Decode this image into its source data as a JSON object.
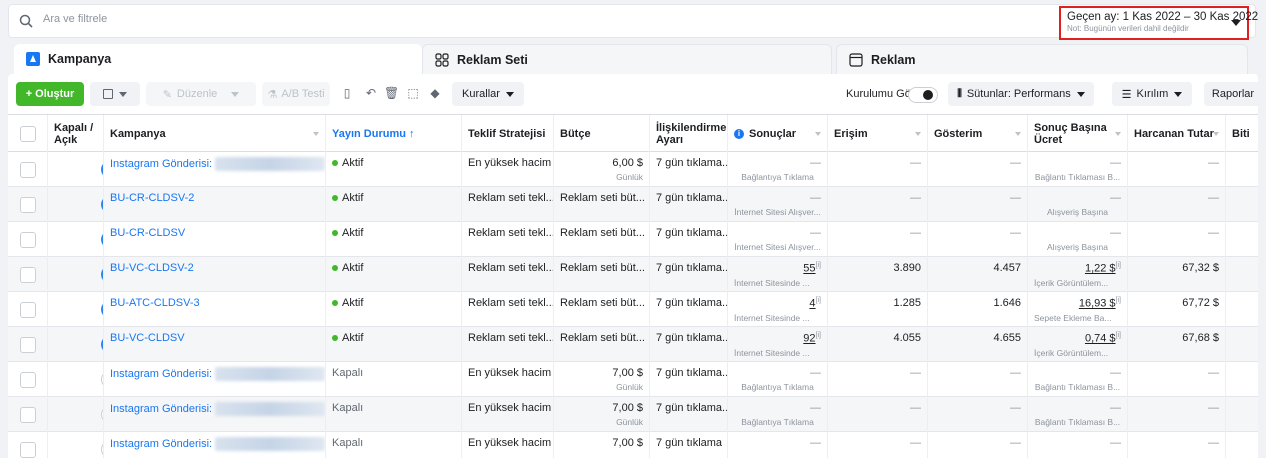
{
  "search": {
    "placeholder": "Ara ve filtrele"
  },
  "date_range": {
    "label": "Geçen ay: 1 Kas 2022 – 30 Kas 2022",
    "note": "Not: Bugünün verileri dahil değildir"
  },
  "tabs": [
    {
      "label": "Kampanya"
    },
    {
      "label": "Reklam Seti"
    },
    {
      "label": "Reklam"
    }
  ],
  "toolbar": {
    "create": "+ Oluştur",
    "edit": "Düzenle",
    "ab_test": "A/B Testi",
    "rules": "Kurallar",
    "setup_view": "Kurulumu Gör",
    "columns": "Sütunlar: Performans",
    "breakdown": "Kırılım",
    "reports": "Raporlar"
  },
  "columns": {
    "onoff": "Kapalı / Açık",
    "campaign": "Kampanya",
    "delivery": "Yayın Durumu ↑",
    "bid": "Teklif Stratejisi",
    "budget": "Bütçe",
    "attribution": "İlişkilendirme Ayarı",
    "results": "Sonuçlar",
    "reach": "Erişim",
    "impressions": "Gösterim",
    "cpr": "Sonuç Başına Ücret",
    "spent": "Harcanan Tutar",
    "ends": "Biti"
  },
  "rows": [
    {
      "on": true,
      "name": "Instagram Gönderisi:",
      "blur": true,
      "status": "Aktif",
      "active": true,
      "bid": "En yüksek hacim",
      "budget": "6,00 $",
      "budget_sub": "Günlük",
      "attr": "7 gün tıklama...",
      "results": "—",
      "results_sub": "Bağlantıya Tıklama",
      "results_link": false,
      "reach": "—",
      "impr": "—",
      "cpr": "—",
      "cpr_sub": "Bağlantı Tıklaması B...",
      "cpr_link": false,
      "spent": "—"
    },
    {
      "on": true,
      "name": "BU-CR-CLDSV-2",
      "blur": false,
      "status": "Aktif",
      "active": true,
      "bid": "Reklam seti tekl...",
      "budget": "Reklam seti büt...",
      "budget_sub": "",
      "attr": "7 gün tıklama...",
      "results": "—",
      "results_sub": "İnternet Sitesi Alışver...",
      "results_link": false,
      "reach": "—",
      "impr": "—",
      "cpr": "—",
      "cpr_sub": "Alışveriş Başına",
      "cpr_link": false,
      "spent": "—"
    },
    {
      "on": true,
      "name": "BU-CR-CLDSV",
      "blur": false,
      "status": "Aktif",
      "active": true,
      "bid": "Reklam seti tekl...",
      "budget": "Reklam seti büt...",
      "budget_sub": "",
      "attr": "7 gün tıklama...",
      "results": "—",
      "results_sub": "İnternet Sitesi Alışver...",
      "results_link": false,
      "reach": "—",
      "impr": "—",
      "cpr": "—",
      "cpr_sub": "Alışveriş Başına",
      "cpr_link": false,
      "spent": "—"
    },
    {
      "on": true,
      "name": "BU-VC-CLDSV-2",
      "blur": false,
      "status": "Aktif",
      "active": true,
      "bid": "Reklam seti tekl...",
      "budget": "Reklam seti büt...",
      "budget_sub": "",
      "attr": "7 gün tıklama...",
      "results": "55",
      "results_sub": "İnternet Sitesinde ...",
      "results_link": true,
      "reach": "3.890",
      "impr": "4.457",
      "cpr": "1,22 $",
      "cpr_sub": "İçerik Görüntülem...",
      "cpr_link": true,
      "spent": "67,32 $"
    },
    {
      "on": true,
      "name": "BU-ATC-CLDSV-3",
      "blur": false,
      "status": "Aktif",
      "active": true,
      "bid": "Reklam seti tekl...",
      "budget": "Reklam seti büt...",
      "budget_sub": "",
      "attr": "7 gün tıklama...",
      "results": "4",
      "results_sub": "İnternet Sitesinde ...",
      "results_link": true,
      "reach": "1.285",
      "impr": "1.646",
      "cpr": "16,93 $",
      "cpr_sub": "Sepete Ekleme Ba...",
      "cpr_link": true,
      "spent": "67,72 $"
    },
    {
      "on": true,
      "name": "BU-VC-CLDSV",
      "blur": false,
      "status": "Aktif",
      "active": true,
      "bid": "Reklam seti tekl...",
      "budget": "Reklam seti büt...",
      "budget_sub": "",
      "attr": "7 gün tıklama...",
      "results": "92",
      "results_sub": "İnternet Sitesinde ...",
      "results_link": true,
      "reach": "4.055",
      "impr": "4.655",
      "cpr": "0,74 $",
      "cpr_sub": "İçerik Görüntülem...",
      "cpr_link": true,
      "spent": "67,68 $"
    },
    {
      "on": false,
      "name": "Instagram Gönderisi:",
      "blur": true,
      "status": "Kapalı",
      "active": false,
      "bid": "En yüksek hacim",
      "budget": "7,00 $",
      "budget_sub": "Günlük",
      "attr": "7 gün tıklama...",
      "results": "—",
      "results_sub": "Bağlantıya Tıklama",
      "results_link": false,
      "reach": "—",
      "impr": "—",
      "cpr": "—",
      "cpr_sub": "Bağlantı Tıklaması B...",
      "cpr_link": false,
      "spent": "—"
    },
    {
      "on": false,
      "name": "Instagram Gönderisi:",
      "blur": true,
      "status": "Kapalı",
      "active": false,
      "bid": "En yüksek hacim",
      "budget": "7,00 $",
      "budget_sub": "Günlük",
      "attr": "7 gün tıklama...",
      "results": "—",
      "results_sub": "Bağlantıya Tıklama",
      "results_link": false,
      "reach": "—",
      "impr": "—",
      "cpr": "—",
      "cpr_sub": "Bağlantı Tıklaması B...",
      "cpr_link": false,
      "spent": "—"
    },
    {
      "on": false,
      "name": "Instagram Gönderisi:",
      "blur": true,
      "status": "Kapalı",
      "active": false,
      "bid": "En yüksek hacim",
      "budget": "7,00 $",
      "budget_sub": "",
      "attr": "7 gün tıklama",
      "results": "—",
      "results_sub": "",
      "results_link": false,
      "reach": "—",
      "impr": "—",
      "cpr": "—",
      "cpr_sub": "",
      "cpr_link": false,
      "spent": "—"
    }
  ]
}
